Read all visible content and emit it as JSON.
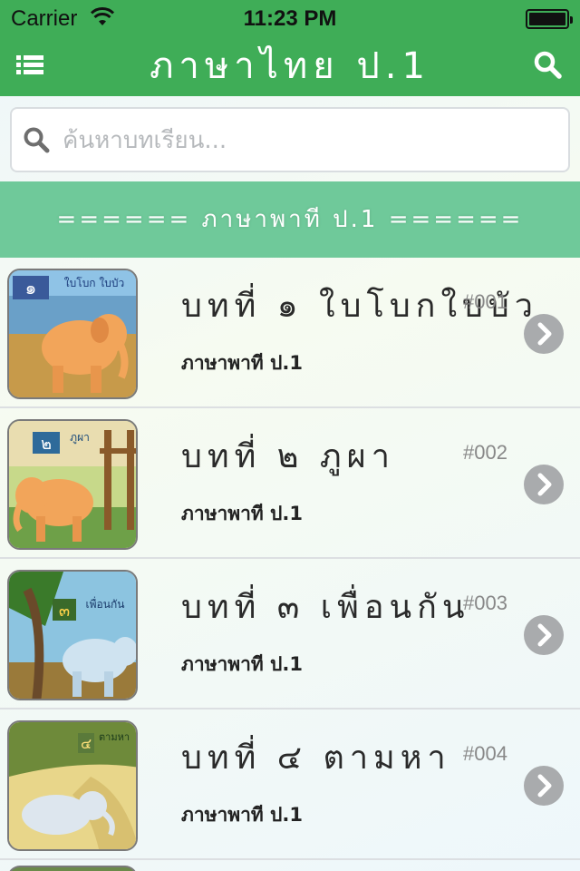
{
  "status_bar": {
    "carrier": "Carrier",
    "time": "11:23 PM"
  },
  "header": {
    "title": "ภาษาไทย ป.1",
    "menu_icon": "list-icon",
    "search_icon": "search-icon",
    "color": "#3fad57"
  },
  "search": {
    "placeholder": "ค้นหาบทเรียน...",
    "value": ""
  },
  "section": {
    "title": "====== ภาษาพาที ป.1 ======",
    "color": "#6fc99a"
  },
  "lessons": [
    {
      "title": "บทที่ ๑ ใบโบกใบบัว",
      "subtitle": "ภาษาพาที ป.1",
      "code": "#001",
      "thumb_label": "ใบโบก ใบบัว",
      "thumb_num": "๑"
    },
    {
      "title": "บทที่ ๒ ภูผา",
      "subtitle": "ภาษาพาที ป.1",
      "code": "#002",
      "thumb_label": "ภูผา",
      "thumb_num": "๒"
    },
    {
      "title": "บทที่ ๓ เพื่อนกัน",
      "subtitle": "ภาษาพาที ป.1",
      "code": "#003",
      "thumb_label": "เพื่อนกัน",
      "thumb_num": "๓"
    },
    {
      "title": "บทที่ ๔ ตามหา",
      "subtitle": "ภาษาพาที ป.1",
      "code": "#004",
      "thumb_label": "ตามหา",
      "thumb_num": "๔"
    }
  ],
  "icons": {
    "chevron": "chevron-right-icon"
  }
}
